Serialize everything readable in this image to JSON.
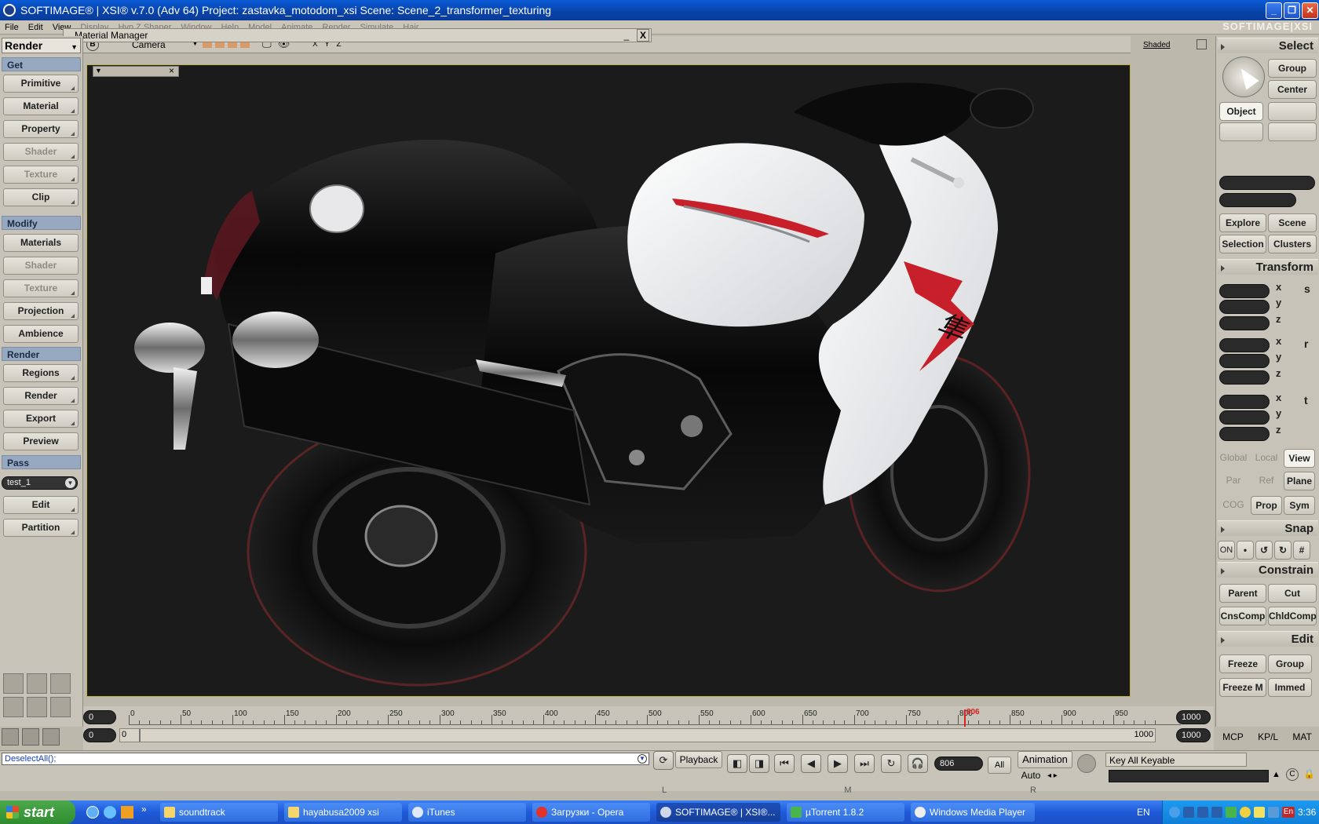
{
  "window": {
    "title": "SOFTIMAGE® | XSI® v.7.0 (Adv 64) Project: zastavka_motodom_xsi    Scene: Scene_2_transformer_texturing",
    "brand": "SOFTIMAGE|XSI"
  },
  "menu": [
    "File",
    "Edit",
    "View",
    "Display",
    "Hyp.Z Shaper",
    "Window",
    "Help",
    "Model",
    "Animate",
    "Render",
    "Simulate",
    "Hair"
  ],
  "material_manager": {
    "title": "Material Manager"
  },
  "viewport": {
    "camera_label": "Camera",
    "axes_label": "X Y Z",
    "display_mode": "Shaded",
    "view_letter": "B"
  },
  "left_panel": {
    "title": "Render",
    "sections": {
      "get": "Get",
      "modify": "Modify",
      "render": "Render",
      "pass": "Pass"
    },
    "get_buttons": [
      "Primitive",
      "Material",
      "Property",
      "Shader",
      "Texture",
      "Clip"
    ],
    "modify_buttons": [
      "Materials",
      "Shader",
      "Texture",
      "Projection",
      "Ambience"
    ],
    "render_buttons": [
      "Regions",
      "Render",
      "Export",
      "Preview"
    ],
    "pass_value": "test_1",
    "pass_buttons": [
      "Edit",
      "Partition"
    ]
  },
  "right_panel": {
    "select_title": "Select",
    "group_btn": "Group",
    "center_btn": "Center",
    "object_btn": "Object",
    "explore_btn": "Explore",
    "scene_btn": "Scene",
    "selection_btn": "Selection",
    "clusters_btn": "Clusters",
    "transform_title": "Transform",
    "axes": [
      "x",
      "y",
      "z"
    ],
    "scale_letter": "s",
    "rot_letter": "r",
    "trans_letter": "t",
    "global_btn": "Global",
    "local_btn": "Local",
    "view_btn": "View",
    "par_btn": "Par",
    "ref_btn": "Ref",
    "plane_btn": "Plane",
    "cog_btn": "COG",
    "prop_btn": "Prop",
    "sym_btn": "Sym",
    "snap_title": "Snap",
    "snap_on": "ON",
    "constrain_title": "Constrain",
    "parent_btn": "Parent",
    "cut_btn": "Cut",
    "cnscomp_btn": "CnsComp",
    "chldcomp_btn": "ChldComp",
    "edit_title": "Edit",
    "freeze_btn": "Freeze",
    "edit_group_btn": "Group",
    "freezem_btn": "Freeze M",
    "immed_btn": "Immed",
    "tabs": [
      "MCP",
      "KP/L",
      "MAT"
    ]
  },
  "timeline": {
    "start_field": "0",
    "end_field": "1000",
    "range_start": "0",
    "range_start_inner": "0",
    "range_end_inner": "1000",
    "range_end": "1000",
    "ticks": [
      "0",
      "50",
      "100",
      "150",
      "200",
      "250",
      "300",
      "350",
      "400",
      "450",
      "500",
      "550",
      "600",
      "650",
      "700",
      "750",
      "800",
      "850",
      "900",
      "950"
    ],
    "current_frame": "806",
    "current_fraction": 0.806
  },
  "controls": {
    "command": "DeselectAll();",
    "playback_label": "Playback",
    "frame_field": "806",
    "all_label": "All",
    "animation_label": "Animation",
    "auto_label": "Auto",
    "key_label": "Key All Keyable",
    "markers": [
      "L",
      "M",
      "R"
    ]
  },
  "taskbar": {
    "start": "start",
    "tasks": [
      "soundtrack",
      "hayabusa2009 xsi",
      "iTunes",
      "Загрузки - Opera",
      "SOFTIMAGE® | XSI®...",
      "µTorrent 1.8.2",
      "Windows Media Player"
    ],
    "lang": "EN",
    "tray_lang": "En",
    "clock": "3:36"
  }
}
